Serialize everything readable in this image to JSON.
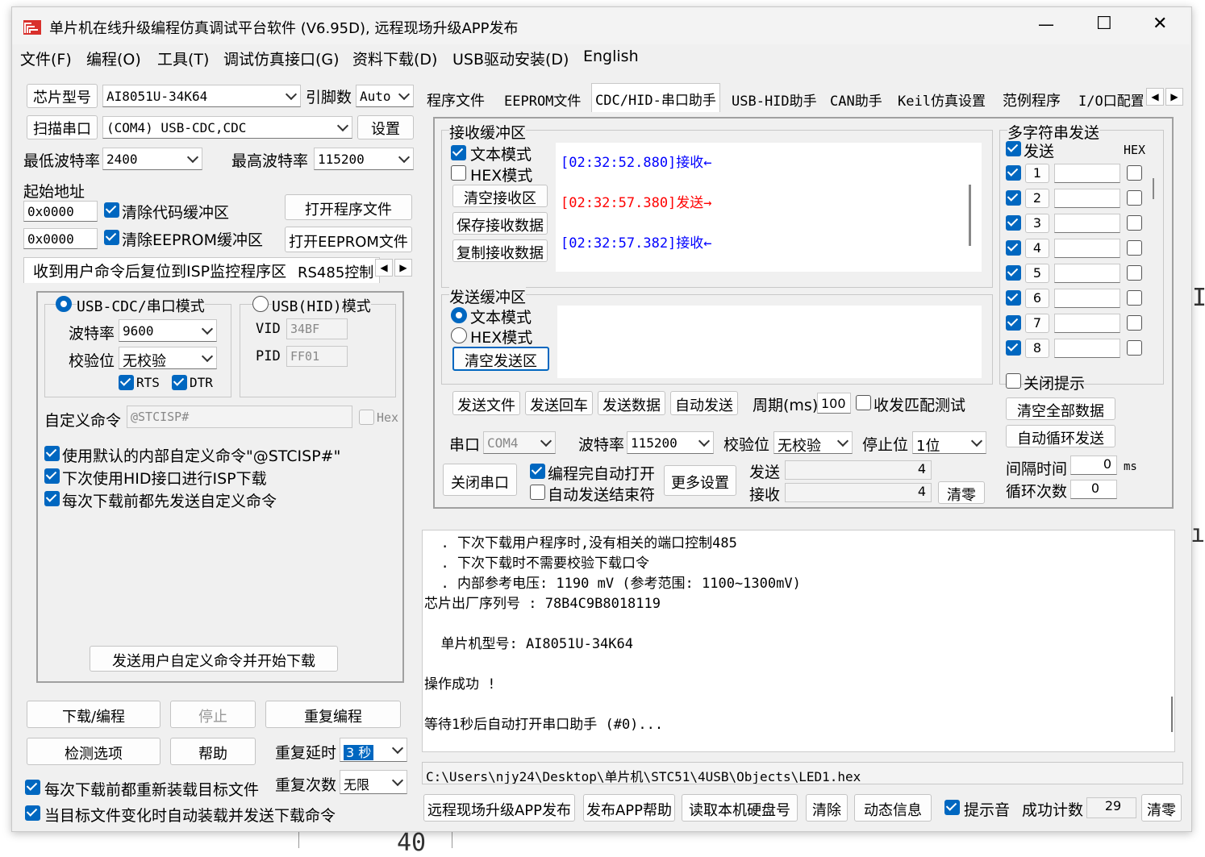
{
  "window": {
    "title": "单片机在线升级编程仿真调试平台软件 (V6.95D), 远程现场升级APP发布",
    "minimize": "—",
    "maximize": "☐",
    "close": "✕"
  },
  "background": {
    "text1": "IC",
    "text2": "ıt",
    "text3": "40"
  },
  "menu": [
    "文件(F)",
    "编程(O)",
    "工具(T)",
    "调试仿真接口(G)",
    "资料下载(D)",
    "USB驱动安装(D)",
    "English"
  ],
  "left": {
    "chip_model_btn": "芯片型号",
    "chip_model_value": "AI8051U-34K64",
    "pin_count_label": "引脚数",
    "pin_count_value": "Auto",
    "scan_port_btn": "扫描串口",
    "port_value": "(COM4) USB-CDC,CDC",
    "settings_btn": "设置",
    "min_baud_label": "最低波特率",
    "min_baud_value": "2400",
    "max_baud_label": "最高波特率",
    "max_baud_value": "115200",
    "start_addr_label": "起始地址",
    "addr1": "0x0000",
    "clear_code_label": "清除代码缓冲区",
    "open_prog_btn": "打开程序文件",
    "addr2": "0x0000",
    "clear_eeprom_label": "清除EEPROM缓冲区",
    "open_eeprom_btn": "打开EEPROM文件",
    "tabs": [
      "收到用户命令后复位到ISP监控程序区",
      "RS485控制"
    ],
    "usbcdc_mode": "USB-CDC/串口模式",
    "usbhid_mode": "USB(HID)模式",
    "baud_label": "波特率",
    "baud_value": "9600",
    "parity_label": "校验位",
    "parity_value": "无校验",
    "rts": "RTS",
    "dtr": "DTR",
    "vid_label": "VID",
    "vid_value": "34BF",
    "pid_label": "PID",
    "pid_value": "FF01",
    "custom_cmd_label": "自定义命令",
    "custom_cmd_value": "@STCISP#",
    "hex_label": "Hex",
    "opt1": "使用默认的内部自定义命令\"@STCISP#\"",
    "opt2": "下次使用HID接口进行ISP下载",
    "opt3": "每次下载前都先发送自定义命令",
    "send_custom_btn": "发送用户自定义命令并开始下载",
    "download_btn": "下载/编程",
    "stop_btn": "停止",
    "reprog_btn": "重复编程",
    "check_btn": "检测选项",
    "help_btn": "帮助",
    "repeat_delay_label": "重复延时",
    "repeat_delay_value": "3 秒",
    "repeat_count_label": "重复次数",
    "repeat_count_value": "无限",
    "reload_label": "每次下载前都重新装载目标文件",
    "auto_load_label": "当目标文件变化时自动装载并发送下载命令"
  },
  "right_tabs": [
    "程序文件",
    "EEPROM文件",
    "CDC/HID-串口助手",
    "USB-HID助手",
    "CAN助手",
    "Keil仿真设置",
    "范例程序",
    "I/O口配置"
  ],
  "serial": {
    "recv_title": "接收缓冲区",
    "text_mode": "文本模式",
    "hex_mode": "HEX模式",
    "clear_recv_btn": "清空接收区",
    "save_recv_btn": "保存接收数据",
    "copy_recv_btn": "复制接收数据",
    "recv_lines": [
      {
        "text": "[02:32:52.880]接收←",
        "color": "#0000ff"
      },
      {
        "text": "[02:32:57.380]发送→",
        "color": "#ff0000"
      },
      {
        "text": "[02:32:57.382]接收←",
        "color": "#0000ff"
      }
    ],
    "send_title": "发送缓冲区",
    "send_text_mode": "文本模式",
    "send_hex_mode": "HEX模式",
    "clear_send_btn": "清空发送区",
    "send_file_btn": "发送文件",
    "send_enter_btn": "发送回车",
    "send_data_btn": "发送数据",
    "auto_send_btn": "自动发送",
    "period_label": "周期(ms)",
    "period_value": "100",
    "match_test_label": "收发匹配测试",
    "port_label": "串口",
    "port_value": "COM4",
    "baud_label": "波特率",
    "baud_value": "115200",
    "parity_label": "校验位",
    "parity_value": "无校验",
    "stop_label": "停止位",
    "stop_value": "1位",
    "close_port_btn": "关闭串口",
    "auto_open_label": "编程完自动打开",
    "auto_send_end_label": "自动发送结束符",
    "more_settings_btn": "更多设置",
    "send_label": "发送",
    "send_count": "4",
    "recv_label": "接收",
    "recv_count": "4",
    "clear_count_btn": "清零"
  },
  "multi": {
    "title": "多字符串发送",
    "send_header": "发送",
    "hex_header": "HEX",
    "rows": [
      "1",
      "2",
      "3",
      "4",
      "5",
      "6",
      "7",
      "8"
    ],
    "close_hint_label": "关闭提示",
    "clear_all_btn": "清空全部数据",
    "auto_loop_btn": "自动循环发送",
    "interval_label": "间隔时间",
    "interval_value": "0",
    "interval_unit": "ms",
    "loop_label": "循环次数",
    "loop_value": "0"
  },
  "log": {
    "lines": [
      "  . 下次下载用户程序时,没有相关的端口控制485",
      "  . 下次下载时不需要校验下载口令",
      "  . 内部参考电压: 1190 mV (参考范围: 1100~1300mV)",
      "芯片出厂序列号 : 78B4C9B8018119",
      "",
      "  单片机型号: AI8051U-34K64",
      "",
      "操作成功 !",
      "",
      "等待1秒后自动打开串口助手 (#0)..."
    ]
  },
  "path": "C:\\Users\\njy24\\Desktop\\单片机\\STC51\\4USB\\Objects\\LED1.hex",
  "bottom": {
    "remote_btn": "远程现场升级APP发布",
    "publish_help_btn": "发布APP帮助",
    "read_disk_btn": "读取本机硬盘号",
    "clear_btn": "清除",
    "dynamic_btn": "动态信息",
    "sound_label": "提示音",
    "success_label": "成功计数",
    "success_value": "29",
    "reset_btn": "清零"
  }
}
